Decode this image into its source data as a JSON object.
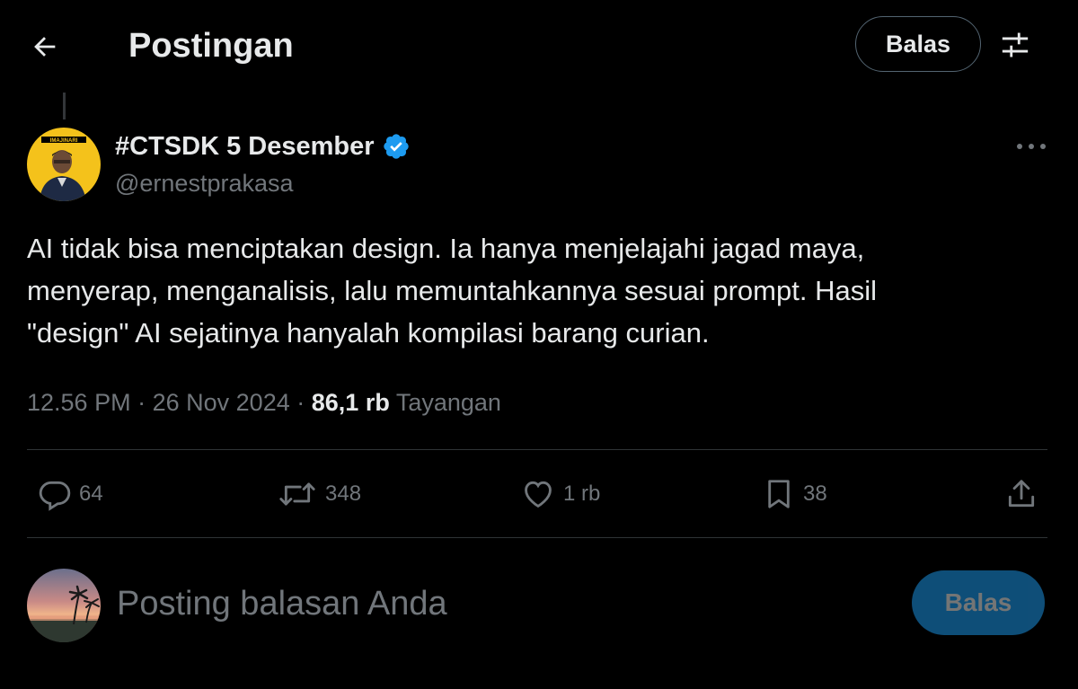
{
  "header": {
    "title": "Postingan",
    "reply_button": "Balas",
    "back_icon": "arrow-left-icon",
    "filter_icon": "sliders-icon"
  },
  "post": {
    "display_name": "#CTSDK 5 Desember",
    "handle": "@ernestprakasa",
    "avatar_badge_text": "IMAJINARI",
    "verified": true,
    "text_lines": [
      "AI tidak bisa menciptakan design. Ia hanya menjelajahi jagad maya,",
      "menyerap, menganalisis, lalu memuntahkannya sesuai prompt. Hasil",
      "\"design\" AI sejatinya hanyalah kompilasi barang curian."
    ],
    "time": "12.56 PM",
    "separator": "·",
    "date": "26 Nov 2024",
    "views_count": "86,1 rb",
    "views_label": "Tayangan"
  },
  "actions": {
    "replies": "64",
    "reposts": "348",
    "likes": "1 rb",
    "bookmarks": "38"
  },
  "reply_box": {
    "placeholder": "Posting balasan Anda",
    "submit_label": "Balas"
  },
  "colors": {
    "background": "#000000",
    "text_primary": "#e7e9ea",
    "text_secondary": "#71767b",
    "divider": "#2f3336",
    "accent": "#1d9bf0",
    "avatar_bg": "#f4c21b"
  }
}
